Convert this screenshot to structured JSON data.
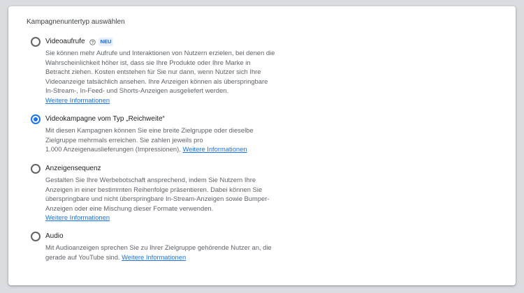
{
  "section": {
    "title": "Kampagnenuntertyp auswählen"
  },
  "colors": {
    "accent": "#1a73e8",
    "text": "#202124",
    "secondary_text": "#5f6368"
  },
  "options": [
    {
      "label": "Videoaufrufe",
      "badge": "NEU",
      "help_icon": "help-circle-icon",
      "selected": false,
      "description_lines": [
        "Sie können mehr Aufrufe und Interaktionen von Nutzern erzielen, bei denen die",
        "Wahrscheinlichkeit höher ist, dass sie Ihre Produkte oder Ihre Marke in",
        "Betracht ziehen. Kosten entstehen für Sie nur dann, wenn Nutzer sich Ihre",
        "Videoanzeige tatsächlich ansehen. Ihre Anzeigen können als überspringbare",
        "In-Stream-, In-Feed- und Shorts-Anzeigen ausgeliefert werden."
      ],
      "link": "Weitere Informationen"
    },
    {
      "label": "Videokampagne vom Typ „Reichweite“",
      "selected": true,
      "description_lines": [
        "Mit diesen Kampagnen können Sie eine breite Zielgruppe oder dieselbe",
        "Zielgruppe mehrmals erreichen. Sie zahlen jeweils pro",
        "1.000 Anzeigenauslieferungen (Impressionen)."
      ],
      "link": "Weitere Informationen"
    },
    {
      "label": "Anzeigensequenz",
      "selected": false,
      "description_lines": [
        "Gestalten Sie Ihre Werbebotschaft ansprechend, indem Sie Nutzern Ihre",
        "Anzeigen in einer bestimmten Reihenfolge präsentieren. Dabei können Sie",
        "überspringbare und nicht überspringbare In-Stream-Anzeigen sowie Bumper-",
        "Anzeigen oder eine Mischung dieser Formate verwenden."
      ],
      "link": "Weitere Informationen"
    },
    {
      "label": "Audio",
      "selected": false,
      "description_lines": [
        "Mit Audioanzeigen sprechen Sie zu Ihrer Zielgruppe gehörende Nutzer an, die",
        "gerade auf YouTube sind."
      ],
      "link": "Weitere Informationen"
    }
  ]
}
